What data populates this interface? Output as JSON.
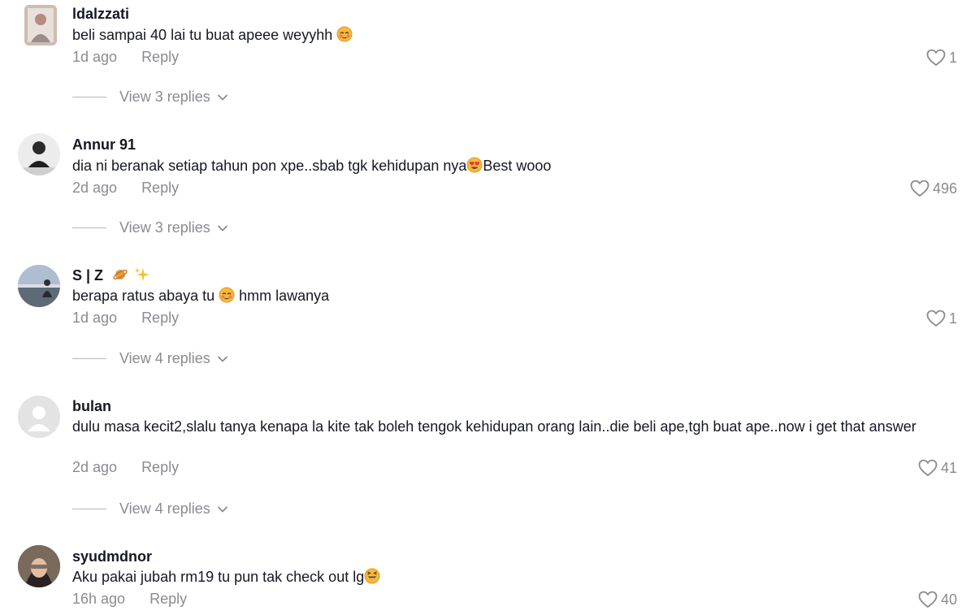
{
  "comments": [
    {
      "username": "ldalzzati",
      "text": "beli sampai 40 lai tu buat apeee weyyhh",
      "time": "1d ago",
      "reply_label": "Reply",
      "likes": "1",
      "replies_label": "View 3 replies"
    },
    {
      "username": "Annur 91",
      "text": "dia ni beranak setiap tahun pon xpe..sbab tgk kehidupan nya",
      "text_after_emoji": "Best wooo",
      "time": "2d ago",
      "reply_label": "Reply",
      "likes": "496",
      "replies_label": "View 3 replies"
    },
    {
      "username": "S | Z",
      "text": "berapa ratus abaya tu",
      "text_after_emoji": " hmm lawanya",
      "time": "1d ago",
      "reply_label": "Reply",
      "likes": "1",
      "replies_label": "View 4 replies"
    },
    {
      "username": "bulan",
      "text": "dulu masa kecit2,slalu tanya kenapa la kite tak boleh tengok kehidupan orang lain..die beli ape,tgh buat ape..now i get that answer",
      "time": "2d ago",
      "reply_label": "Reply",
      "likes": "41",
      "replies_label": "View 4 replies"
    },
    {
      "username": "syudmdnor",
      "text": "Aku pakai jubah rm19 tu pun tak check out lg",
      "time": "16h ago",
      "reply_label": "Reply",
      "likes": "40"
    }
  ],
  "icons": {
    "like": "heart-outline-icon",
    "expand": "chevron-down-icon"
  },
  "colors": {
    "text_primary": "#161823",
    "text_secondary": "#8a8b91",
    "divider": "#b8b8bc"
  }
}
